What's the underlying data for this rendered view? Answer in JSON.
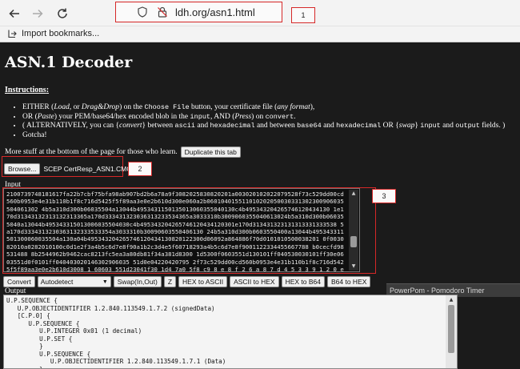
{
  "browser": {
    "url": "ldh.org/asn1.html",
    "annotations": [
      "1",
      "2",
      "3"
    ],
    "bookmarks_import_label": "Import bookmarks..."
  },
  "page": {
    "title": "ASN.1 Decoder",
    "instructions_heading": "Instructions",
    "instructions": [
      {
        "parts": [
          "EITHER (",
          "Load",
          ", or ",
          "Drag&Drop",
          ") on the ",
          "Choose File",
          " button, your certificate file (",
          "any format",
          "),"
        ]
      },
      {
        "parts": [
          "OR (",
          "Paste",
          ") your PEM/base64/hex encoded blob in the ",
          "input",
          ", AND (",
          "Press",
          ") on ",
          "convert",
          "."
        ]
      },
      {
        "parts": [
          "( ALTERNATIVELY, you can {",
          "convert",
          "} between ",
          "ascii",
          " and ",
          "hexadecimal",
          " and between ",
          "base64",
          " and ",
          "hexadecimal",
          " OR {",
          "swap",
          "} ",
          "input",
          " and ",
          "output",
          " fields. )"
        ]
      },
      {
        "parts": [
          "Gotcha!"
        ]
      }
    ],
    "more_stuff": "More stuff at the bottom of the page for those who learn.",
    "duplicate_tab": "Duplicate this tab",
    "browse_label": "Browse...",
    "file_name": "SCEP CertResp_ASN1.CMO",
    "input_label": "Input",
    "input_value": "2100739748181617fa22b7cbf75bfa98ab907bd2b6a78a9f3082025830820201a003020102022079528f73c529dd00cd560b0953e4e31b110b1f8c716d5425f5f89aa3e0e2b610d300e060a2b060104015511010202050030331302300906035504061302 4b5a310d300b06035504a13044b4953431150135013060355040130c4b495343204265746120434130 1e170d31343132313132313365a170d333431323036313233534365a3033310b3009060355040613024b5a310d300b060355040a13044b495343315013006035504030c4b495343204265746120434120301e170d313431323131313331333538 5a170d3334313230363132333533354a3033310b30090603550406130 24b5a310d300b0603550400a13044b495343311501300060035504a130a04b495343204265746120434130820122300d06092a864886f70d0101010500038201 0f003082010a0282010100c0d1e2f3a4b5c6d7e8f90a1b2c3d4e5f60718293a4b5c6d7e8f9001122334455667788 b0cecfd98531488 8b2544962b9462cac8213fc5ea3a80db81f34a381d8300 1d5300f0603551d130101ff040530030101ff30e0603551d0f0101ff040403020146302906035 51d0e04220420795 2f73c529dd00cd560b0953e4e31b110b1f8c716d5425f5f89aa3e0e2b610d3008 1 60603 551d23041f30 1d4 7a0 5f8 c9 8 e 8 f 2 6 a 8 7 d 4 5 3 3 9 1 2 0 e 2 2 7 3 2",
    "buttons": {
      "convert": "Convert",
      "mode": "Autodetect",
      "swap": "Swap(In,Out)",
      "z": "Z",
      "hex_to_ascii": "HEX to ASCII",
      "ascii_to_hex": "ASCII to HEX",
      "hex_to_b64": "HEX to B64",
      "b64_to_hex": "B64 to HEX"
    },
    "tooltip": "PowerPom - Pomodoro Timer",
    "output_label": "Output",
    "output_lines": [
      "U.P.SEQUENCE {",
      "   U.P.OBJECTIDENTIFIER 1.2.840.113549.1.7.2 (signedData)",
      "   [C.P.0] {",
      "      U.P.SEQUENCE {",
      "         U.P.INTEGER 0x01 (1 decimal)",
      "         U.P.SET {",
      "         }",
      "         U.P.SEQUENCE {",
      "            U.P.OBJECTIDENTIFIER 1.2.840.113549.1.7.1 (Data)",
      "         }"
    ]
  }
}
